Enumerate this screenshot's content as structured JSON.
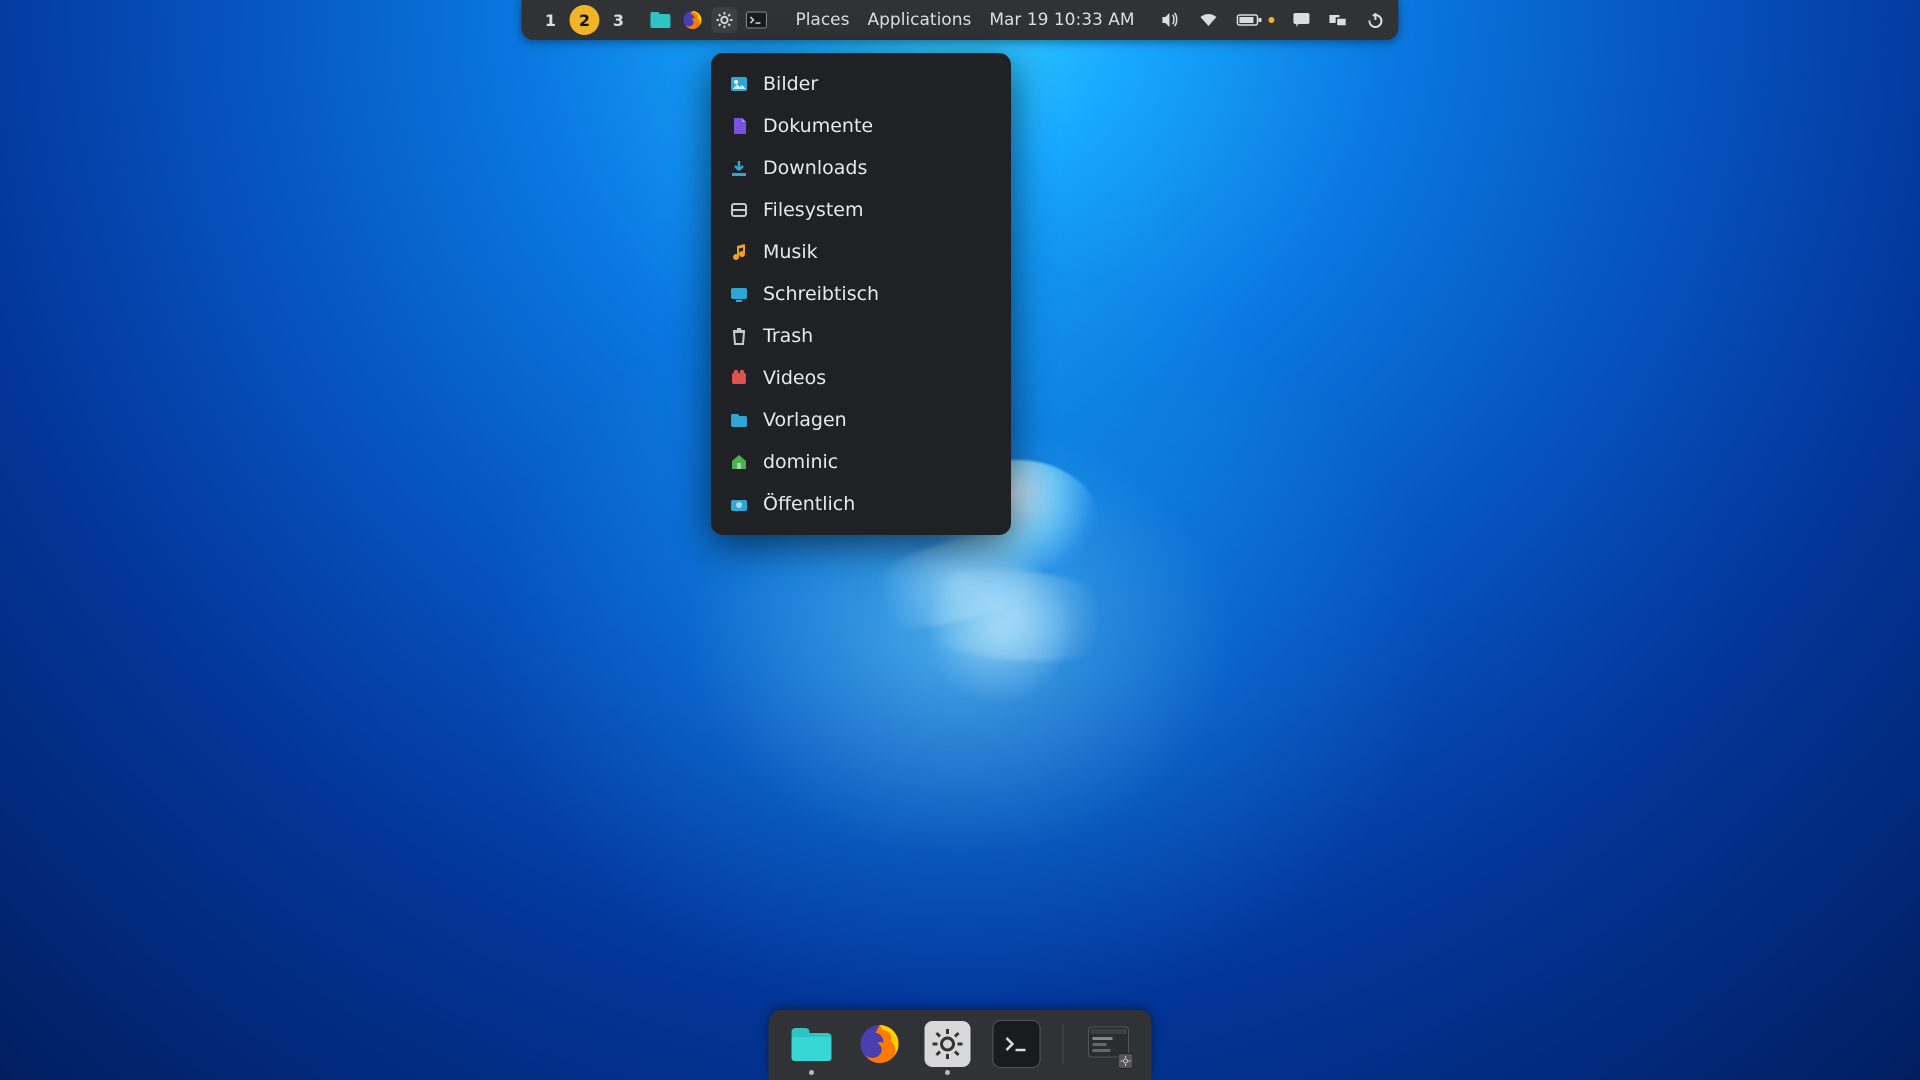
{
  "panel": {
    "workspaces": [
      {
        "label": "1",
        "active": false
      },
      {
        "label": "2",
        "active": true
      },
      {
        "label": "3",
        "active": false
      }
    ],
    "launchers": [
      {
        "name": "files-icon",
        "color": "#2ec4c4"
      },
      {
        "name": "firefox-icon"
      },
      {
        "name": "settings-icon"
      },
      {
        "name": "terminal-icon"
      }
    ],
    "places_label": "Places",
    "applications_label": "Applications",
    "datetime": "Mar 19 10:33 AM",
    "tray": [
      "volume-icon",
      "wifi-icon",
      "battery-icon",
      "chat-icon",
      "workspaces-icon",
      "power-icon"
    ]
  },
  "places_menu": [
    {
      "icon": "pictures-icon",
      "label": "Bilder",
      "color": "#2fa6d6"
    },
    {
      "icon": "documents-icon",
      "label": "Dokumente",
      "color": "#7a52e0"
    },
    {
      "icon": "downloads-icon",
      "label": "Downloads",
      "color": "#2fa6d6"
    },
    {
      "icon": "filesystem-icon",
      "label": "Filesystem",
      "color": "#c8c8c8"
    },
    {
      "icon": "music-icon",
      "label": "Musik",
      "color": "#f0a020"
    },
    {
      "icon": "desktop-icon",
      "label": "Schreibtisch",
      "color": "#2fa6d6"
    },
    {
      "icon": "trash-icon",
      "label": "Trash",
      "color": "#c8c8c8"
    },
    {
      "icon": "videos-icon",
      "label": "Videos",
      "color": "#e05050"
    },
    {
      "icon": "folder-icon",
      "label": "Vorlagen",
      "color": "#2fa6d6"
    },
    {
      "icon": "home-icon",
      "label": "dominic",
      "color": "#4caf50"
    },
    {
      "icon": "public-icon",
      "label": "Öffentlich",
      "color": "#2fa6d6"
    }
  ],
  "dock": [
    {
      "name": "files-app-icon",
      "running": true
    },
    {
      "name": "firefox-app-icon",
      "running": false
    },
    {
      "name": "settings-app-icon",
      "running": true
    },
    {
      "name": "terminal-app-icon",
      "running": false
    }
  ],
  "dock_task": {
    "name": "settings-window-icon"
  }
}
